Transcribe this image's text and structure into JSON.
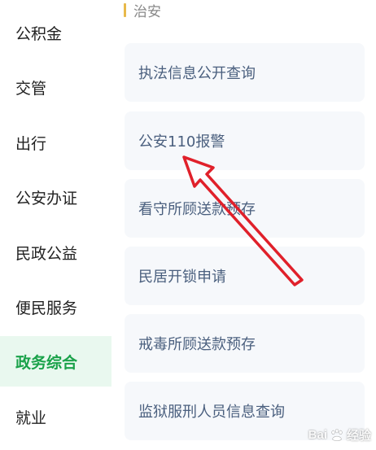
{
  "sidebar": {
    "items": [
      {
        "label": "公积金"
      },
      {
        "label": "交管"
      },
      {
        "label": "出行"
      },
      {
        "label": "公安办证"
      },
      {
        "label": "民政公益"
      },
      {
        "label": "便民服务"
      },
      {
        "label": "政务综合",
        "active": true
      },
      {
        "label": "就业"
      }
    ]
  },
  "main": {
    "section_title": "治安",
    "cards": [
      {
        "label": "执法信息公开查询"
      },
      {
        "label": "公安110报警"
      },
      {
        "label": "看守所顾送款预存"
      },
      {
        "label": "民居开锁申请"
      },
      {
        "label": "戒毒所顾送款预存"
      },
      {
        "label": "监狱服刑人员信息查询"
      }
    ]
  },
  "annotation": {
    "arrow_color": "#e0202a",
    "icon": "red-arrow-icon"
  },
  "watermark": {
    "text_left": "Bai",
    "text_right": "经验",
    "icon": "baidu-paw-icon"
  },
  "colors": {
    "active_text": "#1aa24a",
    "active_bg": "#e9f8ef",
    "card_bg": "#f6f8fb",
    "card_text": "#4a5f7e",
    "section_bar": "#e8b94a"
  }
}
